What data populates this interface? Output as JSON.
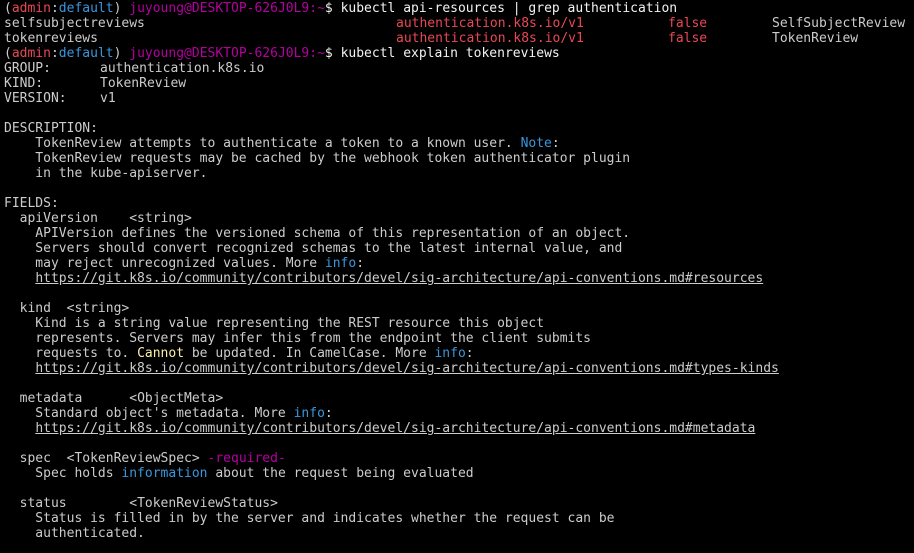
{
  "colors": {
    "background": "#000000",
    "foreground": "#cccccc",
    "red": "#e74856",
    "blue": "#3b78ff",
    "cyan": "#3a96dd",
    "purple": "#b4009e",
    "yellow": "#f9f1a5",
    "green": "#13a10e"
  },
  "prompt": {
    "open_paren": "(",
    "cluster": "admin",
    "sep": ":",
    "namespace": "default",
    "close_paren": ") ",
    "user_host": "juyoung@DESKTOP-626J0L9",
    "path": ":~",
    "dollar": "$ "
  },
  "commands": {
    "first": "kubectl api-resources | grep authentication",
    "second": "kubectl explain tokenreviews"
  },
  "api_resources": [
    {
      "name": "selfsubjectreviews",
      "apiversion": "authentication.k8s.io/v1",
      "namespaced": "false",
      "kind": "SelfSubjectReview"
    },
    {
      "name": "tokenreviews",
      "apiversion": "authentication.k8s.io/v1",
      "namespaced": "false",
      "kind": "TokenReview"
    }
  ],
  "explain": {
    "group_label": "GROUP:",
    "group_value": "authentication.k8s.io",
    "kind_label": "KIND:",
    "kind_value": "TokenReview",
    "version_label": "VERSION:",
    "version_value": "v1",
    "description_label": "DESCRIPTION:",
    "description_1a": "    TokenReview attempts to authenticate a token to a known user. ",
    "description_1b": "Note",
    "description_1c": ":",
    "description_2": "    TokenReview requests may be cached by the webhook token authenticator plugin",
    "description_3": "    in the kube-apiserver.",
    "fields_label": "FIELDS:",
    "fields": {
      "apiversion": {
        "name": "  apiVersion",
        "type": "    <string>",
        "line1": "    APIVersion defines the versioned schema of this representation of an object.",
        "line2": "    Servers should convert recognized schemas to the latest internal value, and",
        "line3a": "    may reject unrecognized values. More ",
        "line3b": "info",
        "line3c": ":",
        "url": "https://git.k8s.io/community/contributors/devel/sig-architecture/api-conventions.md#resources"
      },
      "kind": {
        "name": "  kind",
        "type": "  <string>",
        "line1": "    Kind is a string value representing the REST resource this object",
        "line2": "    represents. Servers may infer this from the endpoint the client submits",
        "line3a": "    requests to. ",
        "line3b": "Cannot",
        "line3c": " be updated. In CamelCase. More ",
        "line3d": "info",
        "line3e": ":",
        "url": "https://git.k8s.io/community/contributors/devel/sig-architecture/api-conventions.md#types-kinds"
      },
      "metadata": {
        "name": "  metadata",
        "type": "      <ObjectMeta>",
        "line1a": "    Standard object's metadata. More ",
        "line1b": "info",
        "line1c": ":",
        "url": "https://git.k8s.io/community/contributors/devel/sig-architecture/api-conventions.md#metadata"
      },
      "spec": {
        "name": "  spec",
        "type": "  <TokenReviewSpec>",
        "required": " -required-",
        "line1a": "    Spec holds ",
        "line1b": "information",
        "line1c": " about the request being evaluated"
      },
      "status": {
        "name": "  status",
        "type": "        <TokenReviewStatus>",
        "line1": "    Status is filled in by the server and indicates whether the request can be",
        "line2": "    authenticated."
      }
    }
  }
}
